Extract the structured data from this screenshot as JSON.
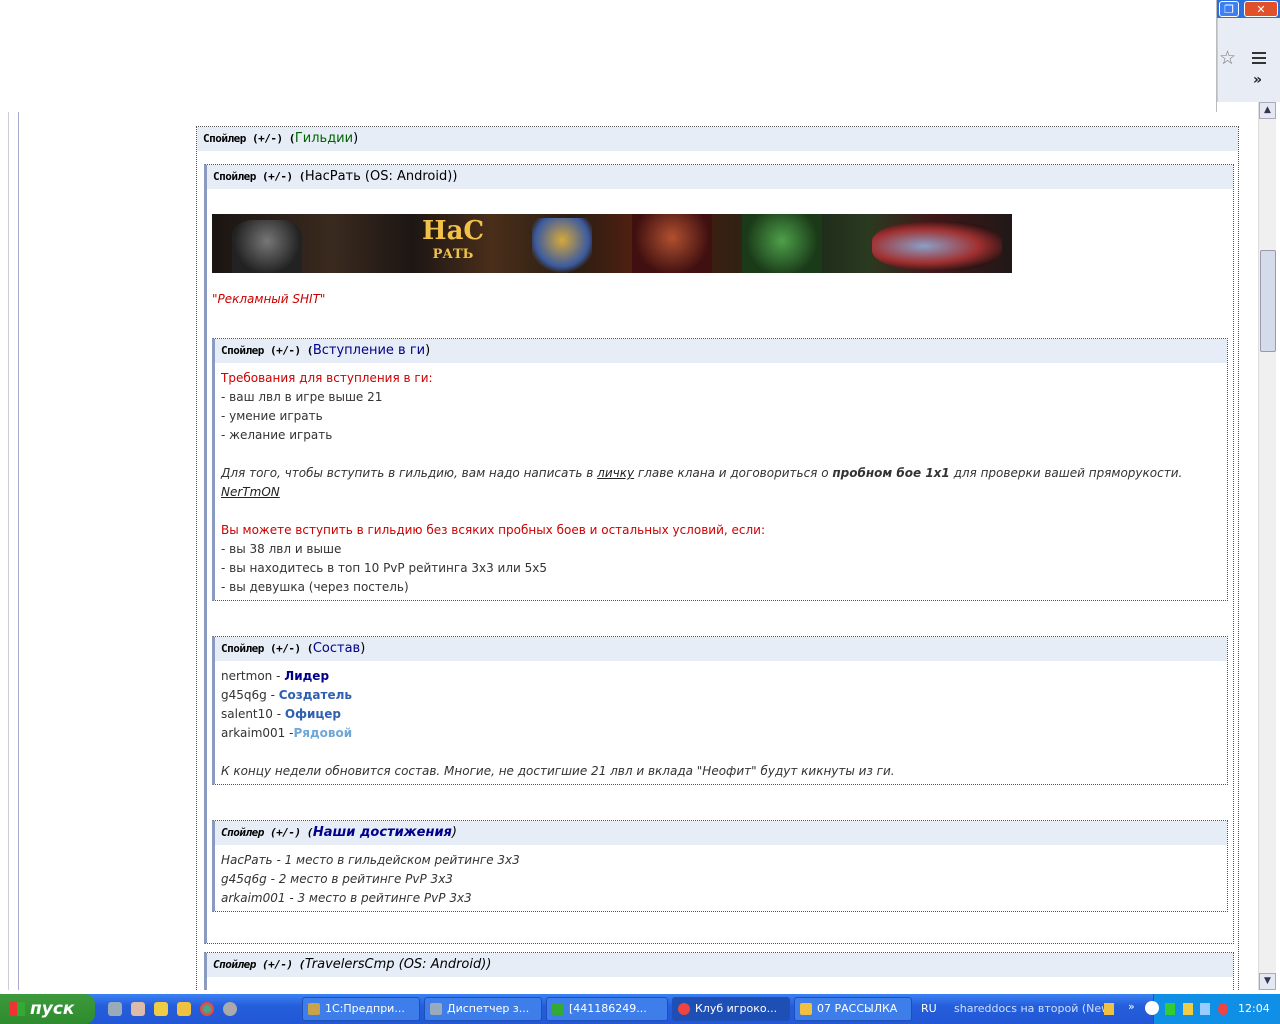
{
  "browser": {
    "window_controls": {
      "restore": "❐",
      "close": "✕"
    },
    "star_icon": "☆",
    "more_icon": "»"
  },
  "post": {
    "guilds_spoiler": {
      "prefix": "Спойлер (+/-) (",
      "title": "Гильдии",
      "suffix": ")"
    },
    "nasrat_spoiler": {
      "prefix": "Спойлер (+/-) (",
      "title": "НасРать (OS: Android)",
      "suffix": ")"
    },
    "banner": {
      "logo_top": "НаС",
      "logo_bottom": "РАТЬ"
    },
    "ad_text": "\"Рекламный SHIT\"",
    "join": {
      "prefix": "Спойлер (+/-) (",
      "title": "Вступление в ги",
      "suffix": ")",
      "requirements_title": "Требования для вступления в ги:",
      "requirements": [
        "- ваш лвл в игре выше 21",
        "- умение играть",
        "- желание играть"
      ],
      "howto_1": "Для того, чтобы вступить в гильдию, вам надо написать в ",
      "howto_link": "личку",
      "howto_2": " главе клана и договориться о ",
      "howto_bold": "пробном бое 1х1",
      "howto_3": " для проверки вашей пряморукости.",
      "leader_link": "NerTmON",
      "nocond_title": "Вы можете вступить в гильдию без всяких пробных боев и остальных условий, если:",
      "nocond": [
        "- вы 38 лвл и выше",
        "- вы находитесь в топ 10 PvP рейтинга 3х3 или 5х5",
        "- вы девушка (через постель)"
      ]
    },
    "roster": {
      "prefix": "Спойлер (+/-) (",
      "title": "Состав",
      "suffix": ")",
      "members": [
        {
          "name": "nertmon - ",
          "role": "Лидер"
        },
        {
          "name": "g45q6g - ",
          "role": "Создатель"
        },
        {
          "name": "salent10 - ",
          "role": "Офицер"
        },
        {
          "name": "arkaim001 -",
          "role": "Рядовой"
        }
      ],
      "note": "К концу недели обновится состав. Многие, не достигшие 21 лвл и вклада \"Неофит\" будут кикнуты из ги."
    },
    "achievements": {
      "prefix": "Спойлер (+/-) (",
      "title": "Наши достижения",
      "suffix": ")",
      "items": [
        "НасРать - 1 место в гильдейском рейтинге 3х3",
        "g45q6g - 2 место в рейтинге PvP 3х3",
        "arkaim001 - 3 место в рейтинге PvP 3х3"
      ]
    },
    "travelers_spoiler": {
      "prefix": "Спойлер (+/-) (",
      "title": "TravelersCmp (OS: Android)",
      "suffix": ")"
    }
  },
  "taskbar": {
    "start_label": "пуск",
    "tasks": [
      {
        "label": "1С:Предпри...",
        "icon_color": "#c9a24a"
      },
      {
        "label": "Диспетчер з...",
        "icon_color": "#9ab"
      },
      {
        "label": "[441186249...",
        "icon_color": "#3a3"
      },
      {
        "label": "Клуб игроко...",
        "icon_color": "#e44"
      },
      {
        "label": "07 РАССЫЛКА",
        "icon_color": "#f0c040"
      }
    ],
    "lang": "RU",
    "shared": "shareddocs на второй (New)",
    "clock": "12:04"
  }
}
